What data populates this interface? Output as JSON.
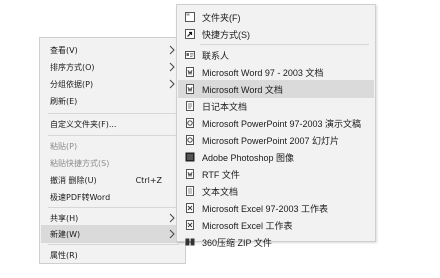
{
  "context_menu": {
    "items": [
      {
        "label": "查看(V)",
        "has_submenu": true
      },
      {
        "label": "排序方式(O)",
        "has_submenu": true
      },
      {
        "label": "分组依据(P)",
        "has_submenu": true
      },
      {
        "label": "刷新(E)"
      },
      {
        "label": "自定义文件夹(F)..."
      },
      {
        "label": "粘贴(P)",
        "disabled": true
      },
      {
        "label": "粘贴快捷方式(S)",
        "disabled": true
      },
      {
        "label": "撤消 删除(U)",
        "shortcut": "Ctrl+Z"
      },
      {
        "label": "极速PDF转Word"
      },
      {
        "label": "共享(H)",
        "has_submenu": true
      },
      {
        "label": "新建(W)",
        "has_submenu": true,
        "highlighted": true
      },
      {
        "label": "属性(R)"
      }
    ]
  },
  "new_submenu": {
    "items": [
      {
        "label": "文件夹(F)",
        "icon": "folder-icon"
      },
      {
        "label": "快捷方式(S)",
        "icon": "shortcut-icon"
      },
      {
        "label": "联系人",
        "icon": "contact-icon"
      },
      {
        "label": "Microsoft Word 97 - 2003 文档",
        "icon": "word-doc-icon"
      },
      {
        "label": "Microsoft Word 文档",
        "icon": "word-doc-icon",
        "highlighted": true
      },
      {
        "label": "日记本文档",
        "icon": "journal-icon"
      },
      {
        "label": "Microsoft PowerPoint 97-2003 演示文稿",
        "icon": "powerpoint-icon"
      },
      {
        "label": "Microsoft PowerPoint 2007 幻灯片",
        "icon": "powerpoint-icon"
      },
      {
        "label": "Adobe Photoshop 图像",
        "icon": "photoshop-icon"
      },
      {
        "label": "RTF 文件",
        "icon": "rtf-icon"
      },
      {
        "label": "文本文档",
        "icon": "text-doc-icon"
      },
      {
        "label": "Microsoft Excel 97-2003 工作表",
        "icon": "excel-icon"
      },
      {
        "label": "Microsoft Excel 工作表",
        "icon": "excel-icon"
      },
      {
        "label": "360压缩 ZIP 文件",
        "icon": "zip-archive-icon"
      }
    ]
  },
  "colors": {
    "menu_background": "#f2f2f2",
    "highlight": "#dadada",
    "disabled_text": "#8d8d8d",
    "separator": "#d7d7d7"
  }
}
